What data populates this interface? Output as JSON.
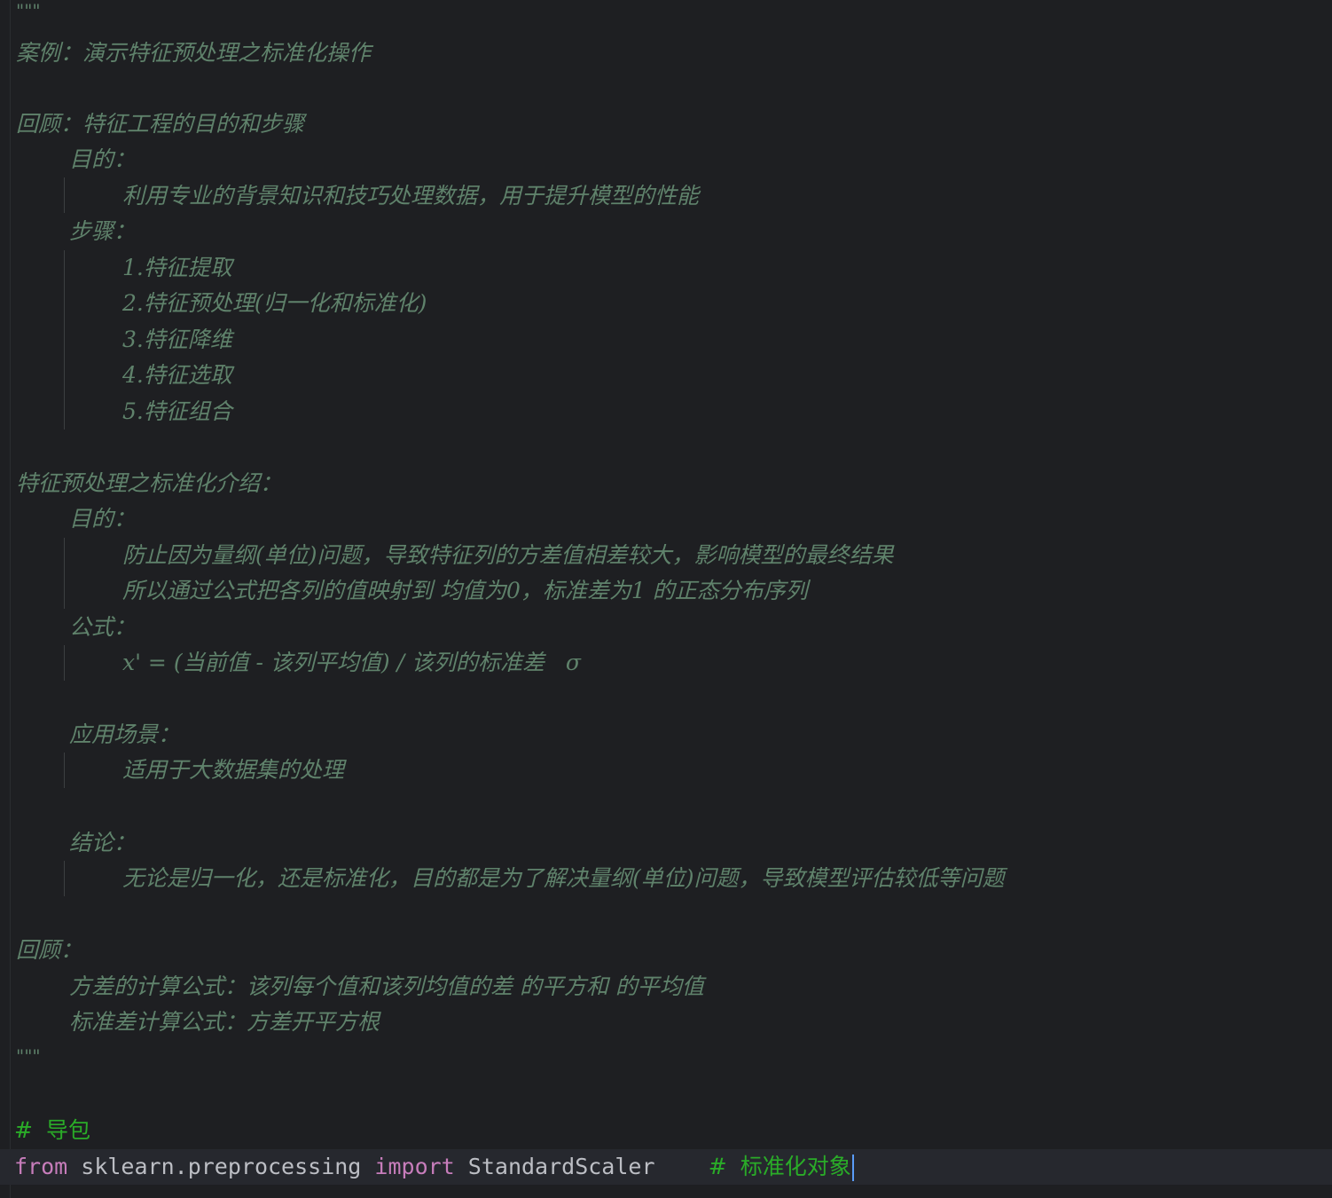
{
  "docstring": {
    "open_quotes": "\"\"\"",
    "close_quotes": "\"\"\"",
    "case_title": "案例：演示特征预处理之标准化操作",
    "review_title": "回顾：特征工程的目的和步骤",
    "purpose_label": "目的：",
    "purpose_text": "利用专业的背景知识和技巧处理数据，用于提升模型的性能",
    "steps_label": "步骤：",
    "steps": [
      "1.特征提取",
      "2.特征预处理(归一化和标准化)",
      "3.特征降维",
      "4.特征选取",
      "5.特征组合"
    ],
    "intro_title": "特征预处理之标准化介绍：",
    "intro_purpose_label": "目的：",
    "intro_purpose_line1": "防止因为量纲(单位)问题，导致特征列的方差值相差较大，影响模型的最终结果",
    "intro_purpose_line2": "所以通过公式把各列的值映射到 均值为0，标准差为1 的正态分布序列",
    "formula_label": "公式：",
    "formula_text": "x' = (当前值 - 该列平均值) / 该列的标准差   σ",
    "scenario_label": "应用场景：",
    "scenario_text": "适用于大数据集的处理",
    "conclusion_label": "结论：",
    "conclusion_text": "无论是归一化，还是标准化，目的都是为了解决量纲(单位)问题，导致模型评估较低等问题",
    "review2_title": "回顾：",
    "variance_formula": "方差的计算公式：该列每个值和该列均值的差 的平方和 的平均值",
    "std_formula": "标准差计算公式：方差开平方根"
  },
  "code": {
    "comment_hash": "#",
    "import_comment": "导包",
    "kw_from": "from",
    "module": "sklearn.preprocessing",
    "kw_import": "import",
    "class_name": "StandardScaler",
    "inline_comment_hash": "#",
    "inline_comment": "标准化对象"
  }
}
